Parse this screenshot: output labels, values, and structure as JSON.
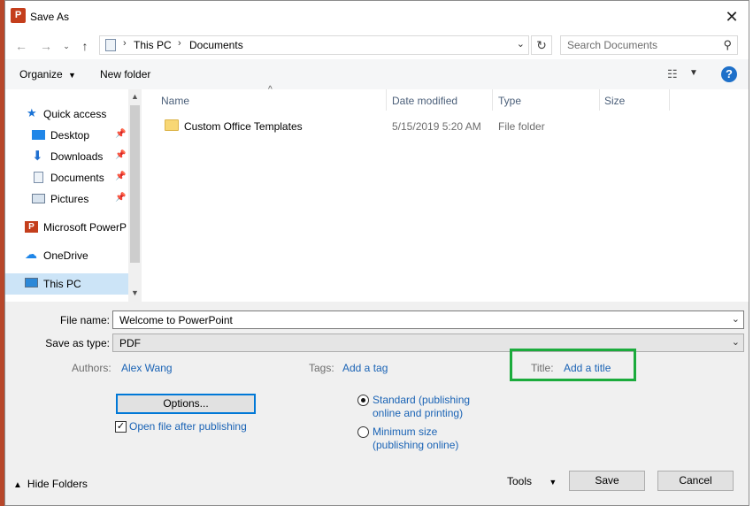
{
  "window": {
    "title": "Save As",
    "app_icon_letter": "P"
  },
  "address": {
    "crumbs": [
      "This PC",
      "Documents"
    ],
    "search_placeholder": "Search Documents"
  },
  "toolbar": {
    "organize": "Organize",
    "new_folder": "New folder",
    "help": "?"
  },
  "nav": {
    "items": [
      {
        "label": "Quick access"
      },
      {
        "label": "Desktop"
      },
      {
        "label": "Downloads"
      },
      {
        "label": "Documents"
      },
      {
        "label": "Pictures"
      },
      {
        "label": "Microsoft PowerP"
      },
      {
        "label": "OneDrive"
      },
      {
        "label": "This PC"
      }
    ]
  },
  "columns": {
    "name": "Name",
    "date": "Date modified",
    "type": "Type",
    "size": "Size"
  },
  "files": [
    {
      "name": "Custom Office Templates",
      "date": "5/15/2019 5:20 AM",
      "type": "File folder",
      "size": ""
    }
  ],
  "form": {
    "file_name_label": "File name:",
    "file_name_value": "Welcome to PowerPoint",
    "save_type_label": "Save as type:",
    "save_type_value": "PDF",
    "authors_label": "Authors:",
    "authors_value": "Alex Wang",
    "tags_label": "Tags:",
    "tags_value": "Add a tag",
    "title_label": "Title:",
    "title_value": "Add a title"
  },
  "options": {
    "options_button": "Options...",
    "open_after_label": "Open file after publishing",
    "open_after_checked": true,
    "standard_line1": "Standard (publishing",
    "standard_line2": "online and printing)",
    "minimum_line1": "Minimum size",
    "minimum_line2": "(publishing online)",
    "selected_optimize": "standard"
  },
  "footer": {
    "hide_folders": "Hide Folders",
    "tools": "Tools",
    "save": "Save",
    "cancel": "Cancel"
  },
  "colors": {
    "accent": "#1a63b5",
    "highlight_box": "#1bab3c",
    "app_red": "#c43e1c"
  }
}
